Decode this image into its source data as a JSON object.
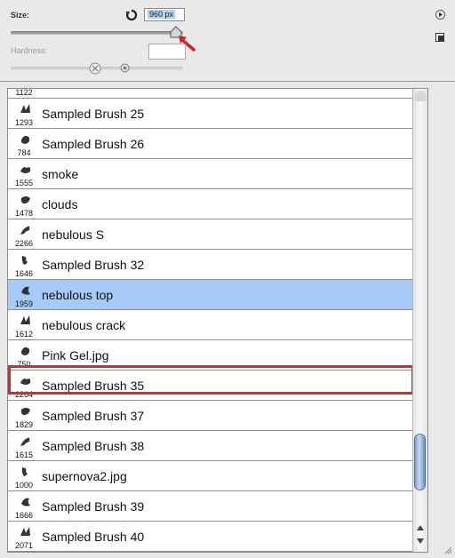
{
  "controls": {
    "size_label": "Size:",
    "size_value": "960 px",
    "size_slider_fraction": 0.96,
    "hardness_label": "Hardness:",
    "hardness_value": "",
    "hardness_slider_fraction": 0.66
  },
  "brushes": [
    {
      "size": "1122",
      "name": ""
    },
    {
      "size": "1293",
      "name": "Sampled Brush 25"
    },
    {
      "size": "784",
      "name": "Sampled Brush 26"
    },
    {
      "size": "1555",
      "name": "smoke"
    },
    {
      "size": "1478",
      "name": "clouds"
    },
    {
      "size": "2266",
      "name": "nebulous S"
    },
    {
      "size": "1646",
      "name": "Sampled Brush 32"
    },
    {
      "size": "1959",
      "name": "nebulous top",
      "selected": true
    },
    {
      "size": "1612",
      "name": "nebulous crack"
    },
    {
      "size": "750",
      "name": "Pink Gel.jpg"
    },
    {
      "size": "2264",
      "name": "Sampled Brush 35"
    },
    {
      "size": "1829",
      "name": "Sampled Brush 37"
    },
    {
      "size": "1615",
      "name": "Sampled Brush 38"
    },
    {
      "size": "1000",
      "name": "supernova2.jpg"
    },
    {
      "size": "1666",
      "name": "Sampled Brush 39"
    },
    {
      "size": "2071",
      "name": "Sampled Brush 40"
    }
  ],
  "colors": {
    "selected_row": "#a6cbfb",
    "highlight_outline": "#e0262a",
    "scroll_thumb": "#8fb0d8"
  }
}
